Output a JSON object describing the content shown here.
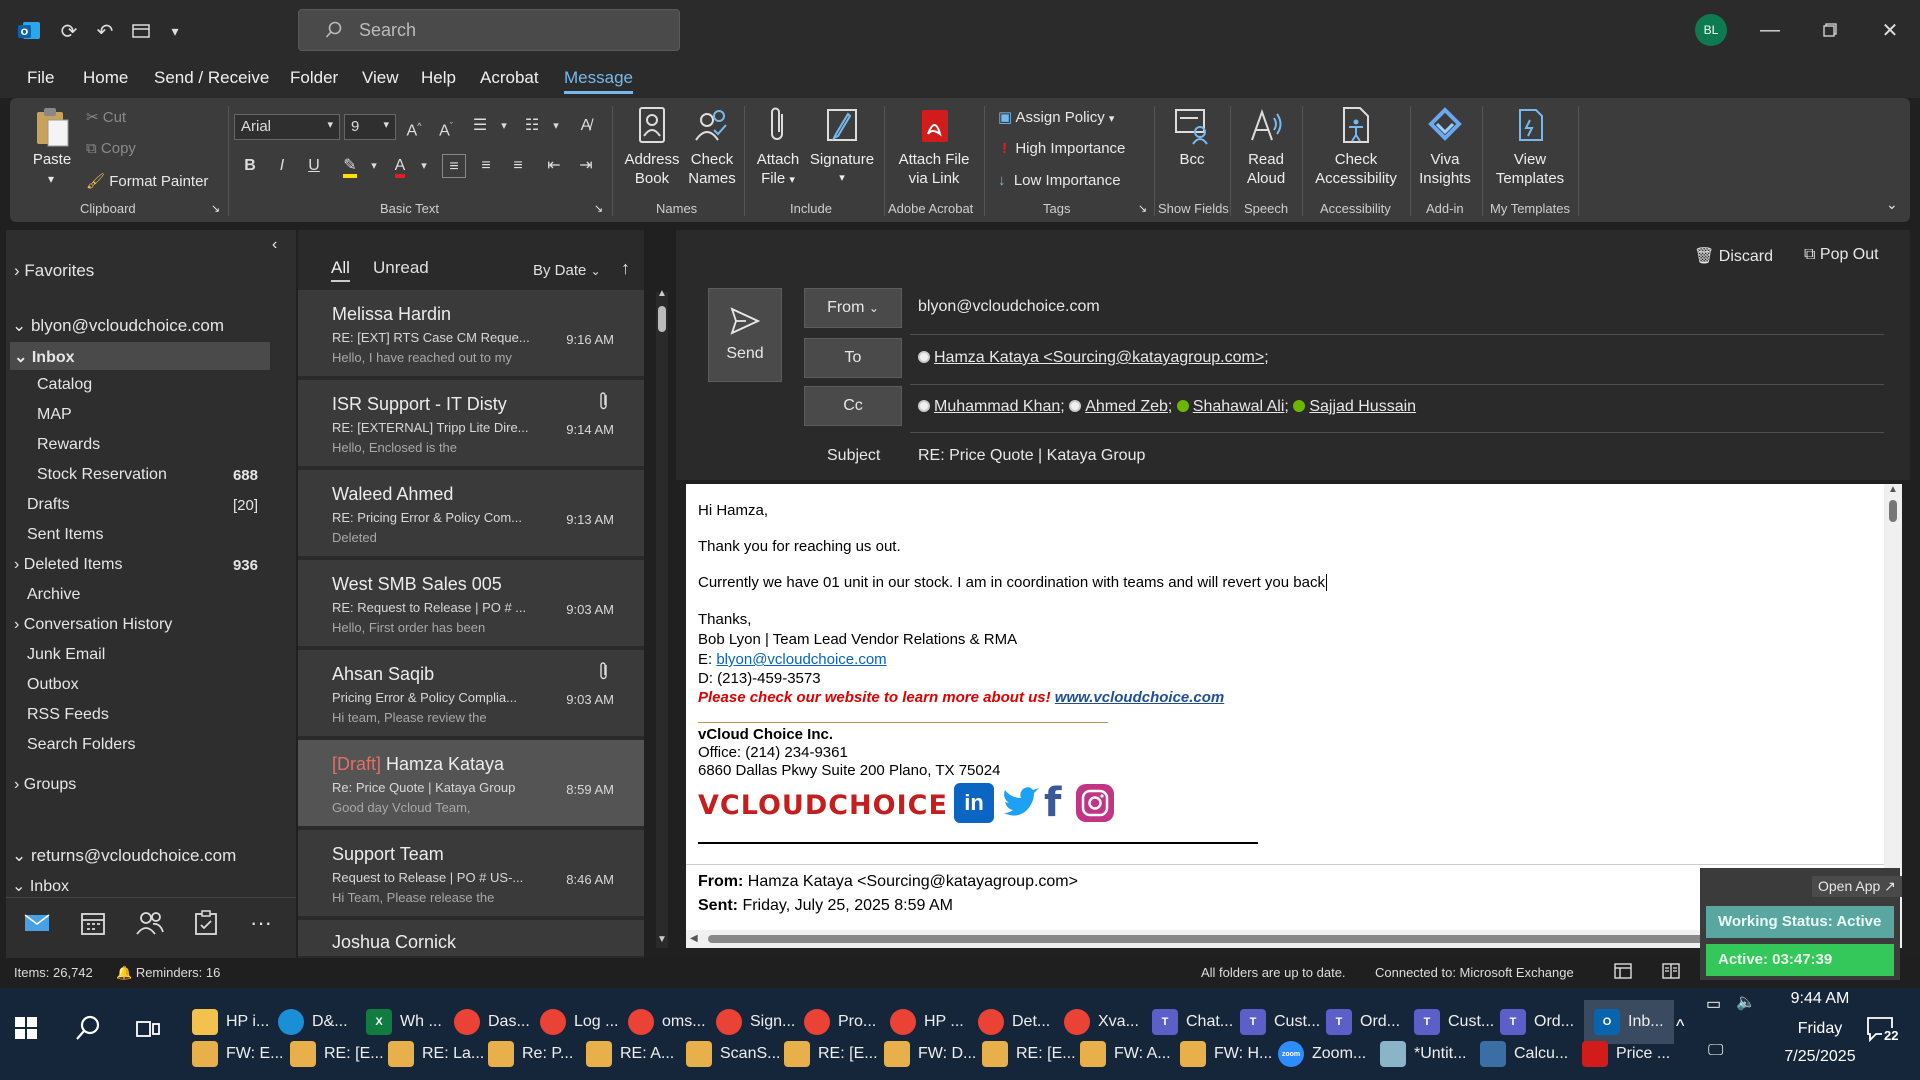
{
  "titlebar": {
    "search_placeholder": "Search",
    "avatar_initials": "BL"
  },
  "menu": {
    "items": [
      "File",
      "Home",
      "Send / Receive",
      "Folder",
      "View",
      "Help",
      "Acrobat",
      "Message"
    ],
    "active": "Message"
  },
  "ribbon": {
    "clipboard": {
      "paste": "Paste",
      "cut": "Cut",
      "copy": "Copy",
      "format_painter": "Format Painter",
      "group": "Clipboard"
    },
    "basic_text": {
      "font": "Arial",
      "size": "9",
      "group": "Basic Text"
    },
    "names": {
      "address_book_1": "Address",
      "address_book_2": "Book",
      "check_names_1": "Check",
      "check_names_2": "Names",
      "group": "Names"
    },
    "include": {
      "attach_file_1": "Attach",
      "attach_file_2": "File",
      "signature": "Signature",
      "group": "Include"
    },
    "adobe": {
      "attach_link_1": "Attach File",
      "attach_link_2": "via Link",
      "group": "Adobe Acrobat"
    },
    "tags": {
      "assign_policy": "Assign Policy",
      "high": "High Importance",
      "low": "Low Importance",
      "group": "Tags"
    },
    "show_fields": {
      "bcc": "Bcc",
      "group": "Show Fields"
    },
    "speech": {
      "read_1": "Read",
      "read_2": "Aloud",
      "group": "Speech"
    },
    "accessibility": {
      "check_1": "Check",
      "check_2": "Accessibility",
      "group": "Accessibility"
    },
    "addin": {
      "viva_1": "Viva",
      "viva_2": "Insights",
      "group": "Add-in"
    },
    "templates": {
      "view_1": "View",
      "view_2": "Templates",
      "group": "My Templates"
    }
  },
  "folders": {
    "favorites": "Favorites",
    "account1": "blyon@vcloudchoice.com",
    "inbox": "Inbox",
    "catalog": "Catalog",
    "map": "MAP",
    "rewards": "Rewards",
    "stock": "Stock Reservation",
    "stock_count": "688",
    "drafts": "Drafts",
    "drafts_count": "[20]",
    "sent": "Sent Items",
    "deleted": "Deleted Items",
    "deleted_count": "936",
    "archive": "Archive",
    "conversation": "Conversation History",
    "junk": "Junk Email",
    "outbox": "Outbox",
    "rss": "RSS Feeds",
    "search_folders": "Search Folders",
    "groups": "Groups",
    "account2": "returns@vcloudchoice.com",
    "inbox2": "Inbox"
  },
  "list": {
    "tab_all": "All",
    "tab_unread": "Unread",
    "sort": "By Date",
    "messages": [
      {
        "draft": "",
        "sender": "Melissa Hardin",
        "subject": "RE: [EXT] RTS Case CM Reque...",
        "preview": "Hello,  I have reached out to my",
        "time": "9:16 AM"
      },
      {
        "draft": "",
        "sender": "ISR Support - IT Disty",
        "subject": "RE: [EXTERNAL] Tripp Lite Dire...",
        "preview": "Hello,  Enclosed is the",
        "time": "9:14 AM"
      },
      {
        "draft": "",
        "sender": "Waleed Ahmed",
        "subject": "RE: Pricing Error & Policy Com...",
        "preview": "Deleted",
        "time": "9:13 AM"
      },
      {
        "draft": "",
        "sender": "West SMB Sales 005",
        "subject": "RE: Request to Release | PO # ...",
        "preview": "Hello,  First order has been",
        "time": "9:03 AM"
      },
      {
        "draft": "",
        "sender": "Ahsan Saqib",
        "subject": "Pricing Error & Policy Complia...",
        "preview": "Hi team,  Please review the",
        "time": "9:03 AM"
      },
      {
        "draft": "[Draft]",
        "sender": " Hamza Kataya",
        "subject": "Re: Price Quote | Kataya Group",
        "preview": "Good day Vcloud Team,",
        "time": "8:59 AM"
      },
      {
        "draft": "",
        "sender": "Support Team",
        "subject": "Request to Release | PO # US-...",
        "preview": "Hi Team,  Please release the",
        "time": "8:46 AM"
      },
      {
        "draft": "",
        "sender": "Joshua Cornick",
        "subject": "",
        "preview": "",
        "time": ""
      }
    ]
  },
  "compose": {
    "discard": "Discard",
    "popout": "Pop Out",
    "send": "Send",
    "from_label": "From",
    "from_value": "blyon@vcloudchoice.com",
    "to_label": "To",
    "to_value": "Hamza Kataya <Sourcing@katayagroup.com>",
    "cc_label": "Cc",
    "cc": [
      "Muhammad Khan",
      "Ahmed Zeb",
      "Shahawal Ali",
      "Sajjad Hussain"
    ],
    "subject_label": "Subject",
    "subject_value": "RE: Price Quote | Kataya Group"
  },
  "body": {
    "greeting": "Hi Hamza,",
    "line1": "Thank you for reaching us out.",
    "line2": "Currently we have 01 unit in our stock. I am in coordination with teams and will revert you back",
    "thanks": "Thanks,",
    "sig_name": "Bob Lyon | Team Lead Vendor Relations & RMA",
    "sig_email_label": "E: ",
    "sig_email": "blyon@vcloudchoice.com",
    "sig_phone": "D: (213)-459-3573",
    "sig_promo": "Please check our website to learn more about us! ",
    "sig_site": "www.vcloudchoice.com",
    "company": "vCloud Choice Inc.",
    "office": "Office: (214) 234-9361",
    "address": "6860 Dallas Pkwy Suite 200 Plano, TX 75024",
    "logo_text": "VCLOUDCHOICE",
    "from_label": "From: ",
    "from_value": "Hamza Kataya <Sourcing@katayagroup.com>",
    "sent_label": "Sent: ",
    "sent_value": "Friday, July 25, 2025 8:59 AM"
  },
  "status": {
    "items": "Items: 26,742",
    "reminders": "Reminders: 16",
    "sync": "All folders are up to date.",
    "connection": "Connected to: Microsoft Exchange"
  },
  "widget": {
    "open_app": "Open App",
    "working": "Working Status: Active",
    "active": "Active: 03:47:39"
  },
  "taskbar": {
    "row1": [
      "HP i...",
      "D&...",
      "Wh ...",
      "Das...",
      "Log ...",
      "oms...",
      "Sign...",
      "Pro...",
      "HP ...",
      "Det...",
      "Xva...",
      "Chat...",
      "Cust...",
      "Ord...",
      "Cust...",
      "Ord...",
      "Inb..."
    ],
    "row2": [
      "FW: E...",
      "RE: [E...",
      "RE: La...",
      "Re: P...",
      "RE: A...",
      "ScanS...",
      "RE: [E...",
      "FW: D...",
      "RE: [E...",
      "FW: A...",
      "FW: H...",
      "Zoom...",
      "*Untit...",
      "Calcu...",
      "Price ..."
    ],
    "time": "9:44 AM",
    "day": "Friday",
    "date": "7/25/2025",
    "notif_count": "22"
  }
}
